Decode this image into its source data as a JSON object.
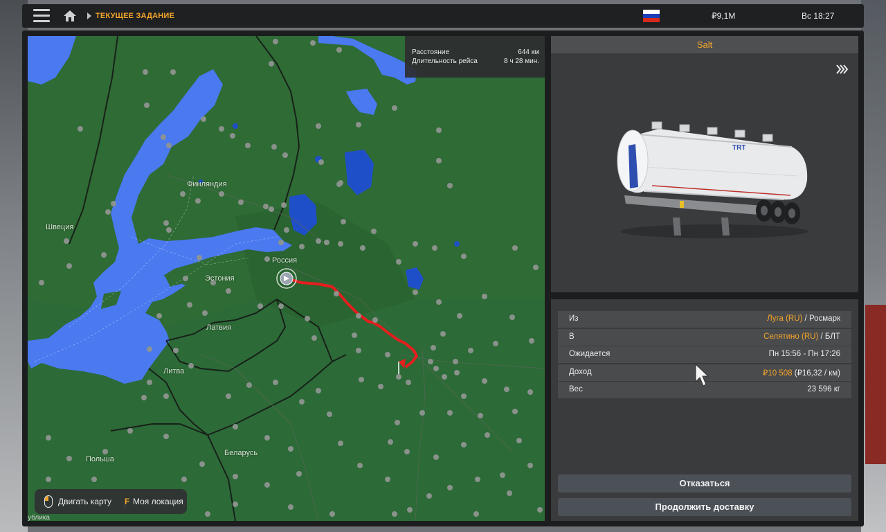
{
  "header": {
    "breadcrumb": "ТЕКУЩЕЕ ЗАДАНИЕ",
    "money": "₽9,1M",
    "clock": "Вс 18:27",
    "flag_colors": [
      "#ffffff",
      "#1c3fb8",
      "#d52b1e"
    ],
    "icons": [
      "menu-icon",
      "home-icon",
      "russia-flag-icon"
    ]
  },
  "map": {
    "distance_label": "Расстояние",
    "distance_value": "644 км",
    "duration_label": "Длительность рейса",
    "duration_value": "8 ч 28 мин.",
    "labels": {
      "finland": "Финляндия",
      "sweden": "Швеция",
      "russia": "Россия",
      "estonia": "Эстония",
      "latvia": "Латвия",
      "lithuania": "Литва",
      "poland": "Польша",
      "belarus": "Беларусь",
      "bottom_partial": "ублика"
    },
    "hint_move": "Двигать карту",
    "hint_key": "F",
    "hint_location": "Моя локация",
    "colors": {
      "land": "#2f6b35",
      "water": "#4a79f0",
      "route": "#e51e1e",
      "city": "#8f9590"
    }
  },
  "cargo": {
    "name": "Salt",
    "icon": "fast-forward-icon"
  },
  "details": {
    "from_label": "Из",
    "from_city": "Луга (RU)",
    "from_company": "Росмарк",
    "to_label": "В",
    "to_city": "Селятино (RU)",
    "to_company": "БЛТ",
    "eta_label": "Ожидается",
    "eta_value": "Пн 15:56 - Пн 17:26",
    "income_label": "Доход",
    "income_value": "₽10 508",
    "income_rate": "(₽16,32 / км)",
    "weight_label": "Вес",
    "weight_value": "23 596 кг",
    "separator": " / "
  },
  "actions": {
    "decline": "Отказаться",
    "continue": "Продолжить доставку"
  }
}
